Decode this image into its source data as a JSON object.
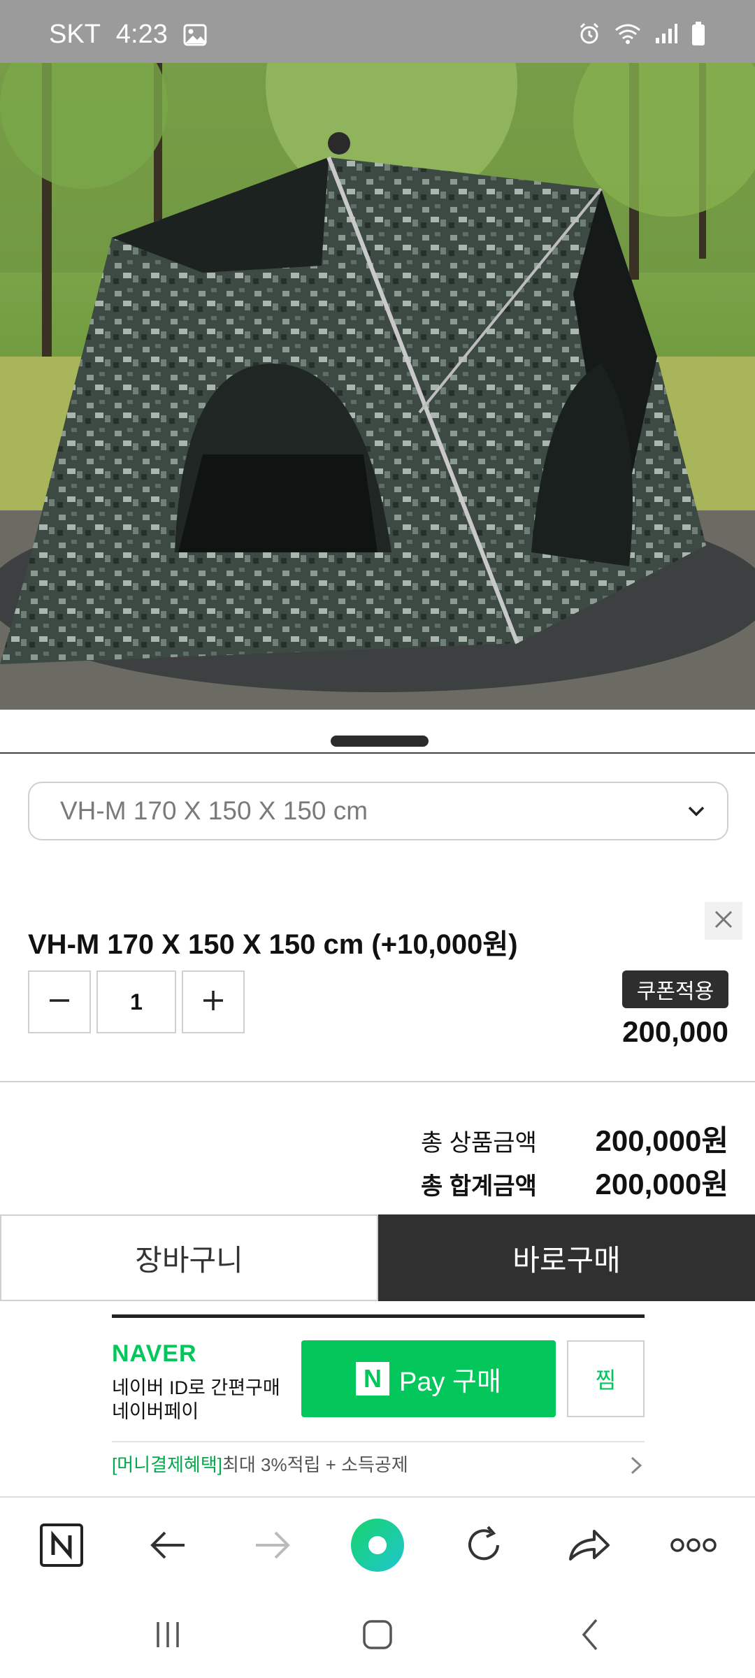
{
  "status_bar": {
    "carrier": "SKT",
    "time": "4:23",
    "icons": [
      "image-icon",
      "alarm-icon",
      "wifi-icon",
      "signal-icon",
      "battery-icon"
    ]
  },
  "product_image": {
    "icon": "tent-photo"
  },
  "option_select": {
    "selected": "VH-M 170 X 150 X 150 cm"
  },
  "selected_option": {
    "title": "VH-M 170 X 150 X 150 cm (+10,000원)",
    "quantity": "1",
    "coupon_label": "쿠폰적용",
    "price": "200,000"
  },
  "summary": {
    "product_total_label": "총 상품금액",
    "product_total_value": "200,000원",
    "grand_total_label": "총 합계금액",
    "grand_total_value": "200,000원"
  },
  "actions": {
    "cart_label": "장바구니",
    "buy_now_label": "바로구매"
  },
  "naver_pay": {
    "brand": "NAVER",
    "line1": "네이버 ID로 간편구매",
    "line2": "네이버페이",
    "pay_n": "N",
    "pay_label": "Pay 구매",
    "wish_label": "찜",
    "benefit_tag": "[머니결제혜택]",
    "benefit_text": "최대 3%적립 + 소득공제"
  },
  "browser_nav": {
    "home_letter": "N",
    "icons": [
      "naver-home-icon",
      "back-arrow-icon",
      "forward-arrow-icon",
      "green-dot-icon",
      "refresh-icon",
      "share-icon",
      "more-icon"
    ]
  },
  "system_nav": {
    "icons": [
      "recents-icon",
      "home-icon",
      "back-icon"
    ]
  },
  "colors": {
    "accent_green": "#03c75a",
    "dark_button": "#303030",
    "status_bar": "#9b9b9b"
  }
}
